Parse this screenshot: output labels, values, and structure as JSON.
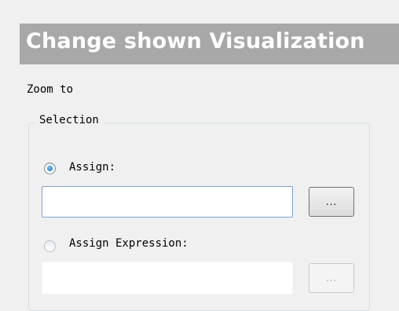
{
  "header": {
    "title": "Change shown Visualization"
  },
  "zoom": {
    "label": "Zoom to",
    "group_label": "Selection",
    "options": [
      {
        "label": "Assign:",
        "selected": true,
        "input_value": "",
        "browse_label": "...",
        "enabled": true
      },
      {
        "label": "Assign Expression:",
        "selected": false,
        "input_value": "",
        "browse_label": "...",
        "enabled": false
      }
    ]
  },
  "colors": {
    "title_bar": "#a8a8a8",
    "background": "#f0f0f0",
    "input_border": "#7da2ce"
  }
}
